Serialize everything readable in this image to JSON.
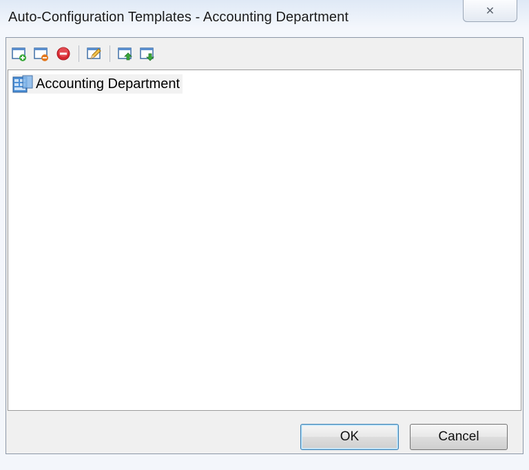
{
  "window": {
    "title": "Auto-Configuration Templates - Accounting Department",
    "close_glyph": "✕"
  },
  "toolbar": {
    "buttons": [
      {
        "name": "add-template",
        "icon": "window-add-icon"
      },
      {
        "name": "remove-template",
        "icon": "window-remove-icon"
      },
      {
        "name": "delete",
        "icon": "stop-icon"
      },
      {
        "name": "edit",
        "icon": "pencil-icon"
      },
      {
        "name": "move-up",
        "icon": "window-arrow-up-icon"
      },
      {
        "name": "move-down",
        "icon": "window-arrow-down-icon"
      }
    ]
  },
  "tree": {
    "items": [
      {
        "label": "Accounting Department",
        "icon": "department-icon"
      }
    ]
  },
  "footer": {
    "ok_label": "OK",
    "cancel_label": "Cancel"
  },
  "colors": {
    "accent": "#3c7fb1",
    "add_green": "#3aa83a",
    "remove_orange": "#e2781f",
    "stop_red": "#d7262e"
  }
}
